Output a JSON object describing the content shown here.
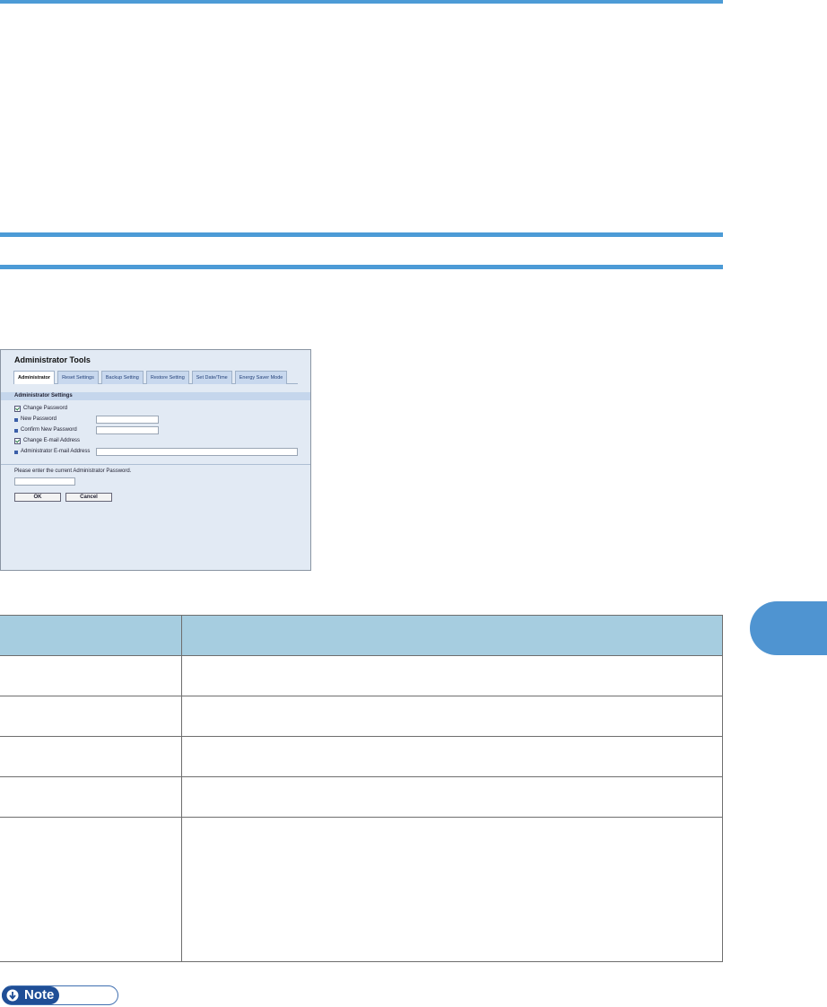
{
  "screenshot": {
    "title": "Administrator Tools",
    "tabs": [
      "Administrator",
      "Reset Settings",
      "Backup Setting",
      "Restore Setting",
      "Set Date/Time",
      "Energy Saver Mode"
    ],
    "section_title": "Administrator Settings",
    "change_password_label": "Change Password",
    "new_password_label": "New Password",
    "confirm_password_label": "Confirm New Password",
    "change_email_label": "Change E-mail Address",
    "admin_email_label": "Administrator E-mail Address",
    "current_password_prompt": "Please enter the current Administrator Password.",
    "ok_label": "OK",
    "cancel_label": "Cancel"
  },
  "note": {
    "label": "Note"
  },
  "colors": {
    "rule": "#4c9bd6",
    "table_header": "#a6cde0",
    "chapter_tab": "#4f94d1",
    "note": "#1f4e96"
  }
}
